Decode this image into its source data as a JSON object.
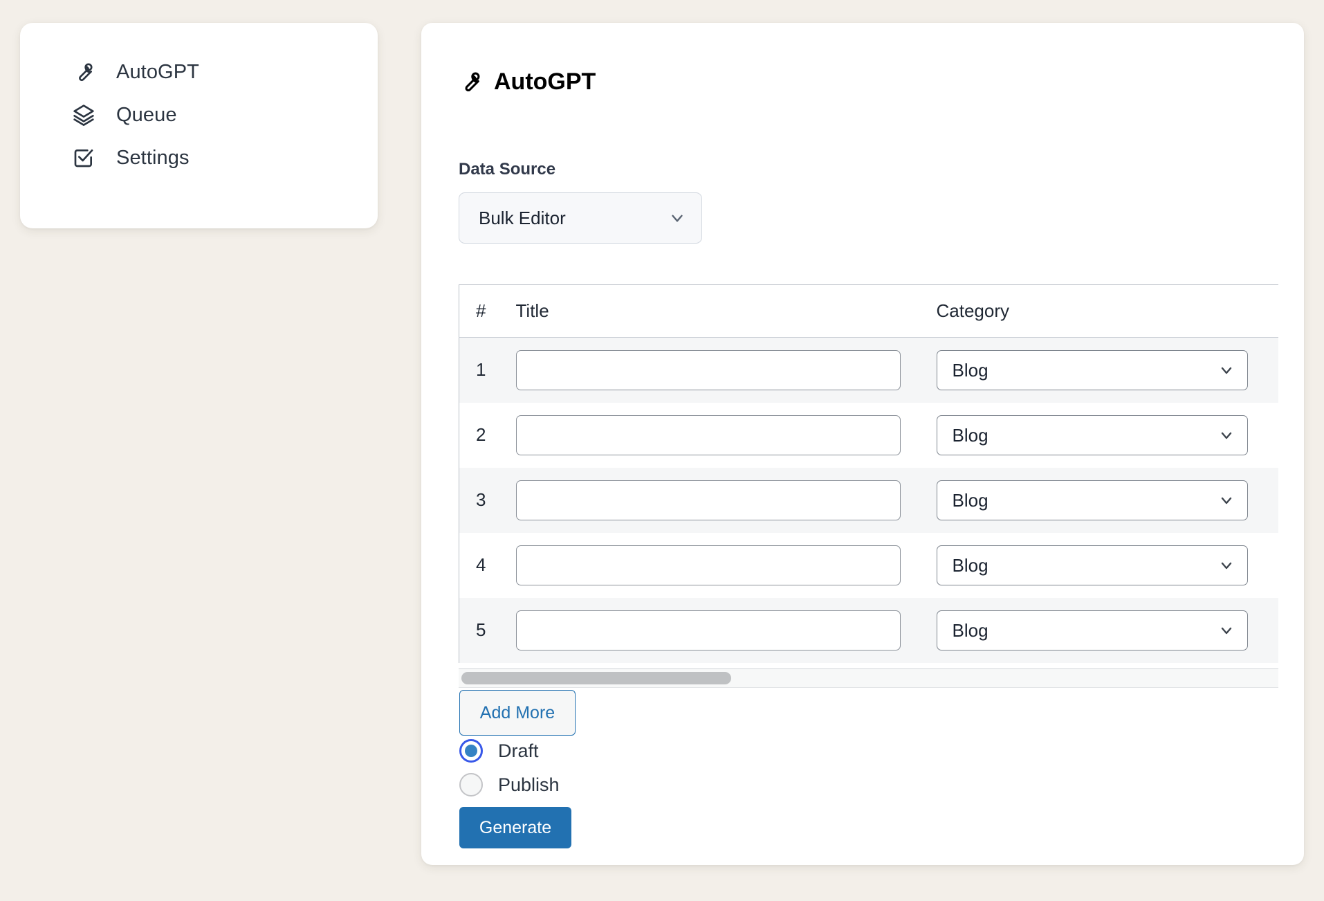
{
  "sidebar": {
    "items": [
      {
        "label": "AutoGPT",
        "icon": "wrench-icon"
      },
      {
        "label": "Queue",
        "icon": "layers-icon"
      },
      {
        "label": "Settings",
        "icon": "check-square-icon"
      }
    ]
  },
  "panel": {
    "title": "AutoGPT",
    "title_icon": "wrench-icon",
    "data_source": {
      "label": "Data Source",
      "value": "Bulk Editor",
      "chevron_icon": "chevron-down-icon"
    },
    "table": {
      "columns": [
        "#",
        "Title",
        "Category"
      ],
      "rows": [
        {
          "num": "1",
          "title": "",
          "title_placeholder": "",
          "category": "Blog"
        },
        {
          "num": "2",
          "title": "",
          "title_placeholder": "",
          "category": "Blog"
        },
        {
          "num": "3",
          "title": "",
          "title_placeholder": "",
          "category": "Blog"
        },
        {
          "num": "4",
          "title": "",
          "title_placeholder": "",
          "category": "Blog"
        },
        {
          "num": "5",
          "title": "",
          "title_placeholder": "",
          "category": "Blog"
        }
      ]
    },
    "add_more_label": "Add More",
    "status_options": [
      {
        "label": "Draft",
        "checked": true
      },
      {
        "label": "Publish",
        "checked": false
      }
    ],
    "generate_label": "Generate"
  },
  "colors": {
    "page_background": "#f3efe9",
    "card_background": "#ffffff",
    "accent_blue": "#2271b1",
    "radio_ring": "#3858e9",
    "text_dark": "#2b3440",
    "row_alt": "#f5f6f7"
  }
}
